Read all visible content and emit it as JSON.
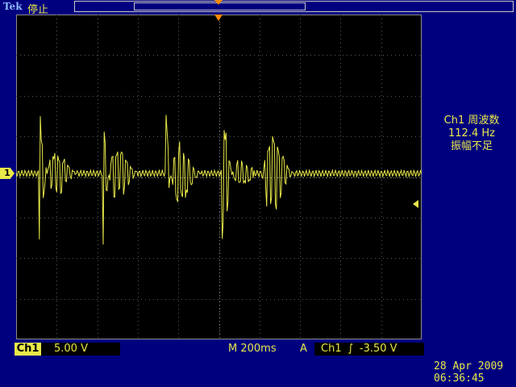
{
  "header": {
    "brand": "Tek",
    "run_state": "停止"
  },
  "channel": {
    "marker_label": "1"
  },
  "measurement": {
    "line1": "Ch1 周波数",
    "line2": "112.4 Hz",
    "line3": "振幅不足"
  },
  "status_bar": {
    "channel_label": "Ch1",
    "volts_per_div": "5.00 V",
    "timebase": "M 200ms",
    "trigger_mode_label": "A",
    "trigger_source": "Ch1",
    "trigger_slope_icon": "rising-edge-icon",
    "trigger_level": "-3.50 V"
  },
  "datetime": {
    "date": "28 Apr  2009",
    "time": "06:36:45"
  },
  "colors": {
    "trace": "#e8e84a",
    "background": "#00007f",
    "screen": "#000000",
    "trigger_marker": "#ff8a00"
  }
}
